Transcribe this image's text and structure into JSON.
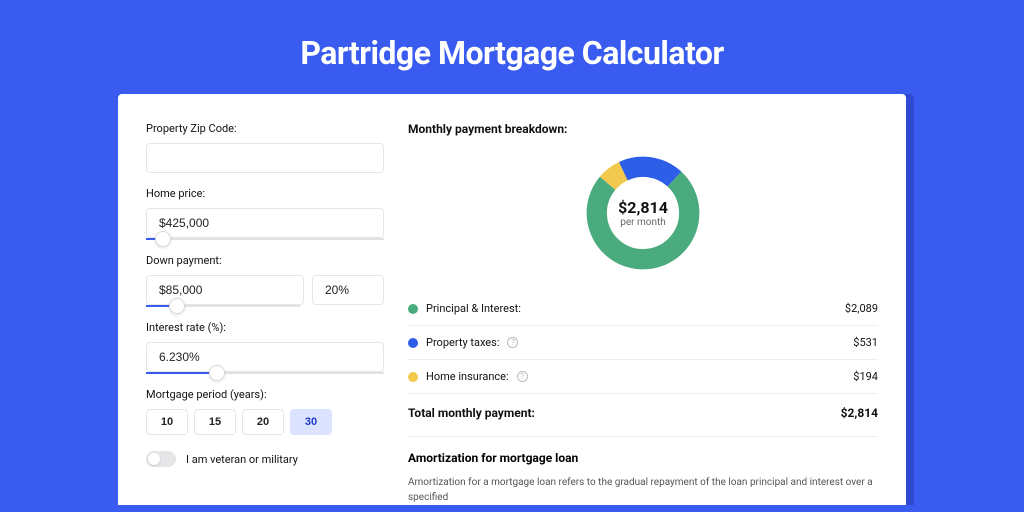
{
  "title": "Partridge Mortgage Calculator",
  "form": {
    "zip_label": "Property Zip Code:",
    "zip_value": "",
    "home_price_label": "Home price:",
    "home_price_value": "$425,000",
    "home_price_slider_pct": 7,
    "down_payment_label": "Down payment:",
    "down_payment_value": "$85,000",
    "down_payment_pct_value": "20%",
    "down_payment_slider_pct": 20,
    "interest_label": "Interest rate (%):",
    "interest_value": "6.230%",
    "interest_slider_pct": 30,
    "period_label": "Mortgage period (years):",
    "period_options": [
      "10",
      "15",
      "20",
      "30"
    ],
    "period_selected": "30",
    "veteran_label": "I am veteran or military",
    "veteran_on": false
  },
  "breakdown": {
    "title": "Monthly payment breakdown:",
    "center_amount": "$2,814",
    "center_sub": "per month",
    "items": [
      {
        "label": "Principal & Interest:",
        "value": "$2,089",
        "color": "green",
        "info": false,
        "numeric": 2089
      },
      {
        "label": "Property taxes:",
        "value": "$531",
        "color": "blue",
        "info": true,
        "numeric": 531
      },
      {
        "label": "Home insurance:",
        "value": "$194",
        "color": "yellow",
        "info": true,
        "numeric": 194
      }
    ],
    "total_label": "Total monthly payment:",
    "total_value": "$2,814"
  },
  "amort": {
    "title": "Amortization for mortgage loan",
    "text": "Amortization for a mortgage loan refers to the gradual repayment of the loan principal and interest over a specified"
  },
  "chart_data": {
    "type": "pie",
    "title": "Monthly payment breakdown",
    "series": [
      {
        "name": "Principal & Interest",
        "value": 2089,
        "color": "#4aab7e"
      },
      {
        "name": "Property taxes",
        "value": 531,
        "color": "#2d5ee8"
      },
      {
        "name": "Home insurance",
        "value": 194,
        "color": "#f2c94c"
      }
    ],
    "total": 2814,
    "unit": "USD per month"
  }
}
